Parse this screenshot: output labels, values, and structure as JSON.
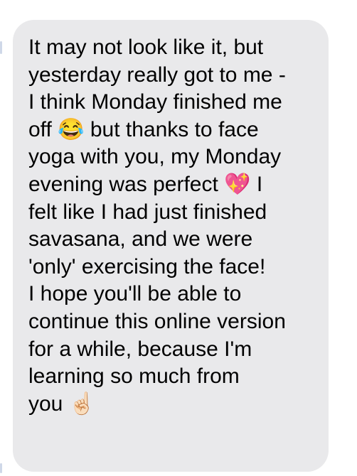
{
  "message": {
    "lines": [
      "It may not look like it, but",
      "yesterday really got to me -",
      "I think Monday finished me",
      "off 😂 but thanks to face",
      "yoga with you, my Monday",
      "evening was perfect 💖 I",
      "felt like I had just finished",
      "savasana, and we were",
      "'only' exercising the face!",
      "I hope you'll be able to",
      "continue this online version",
      "for a while, because I'm",
      "learning so much from",
      "you ☝🏻"
    ]
  },
  "colors": {
    "bubble_background": "#e9e9eb",
    "text": "#000000",
    "page_background": "#ffffff"
  }
}
